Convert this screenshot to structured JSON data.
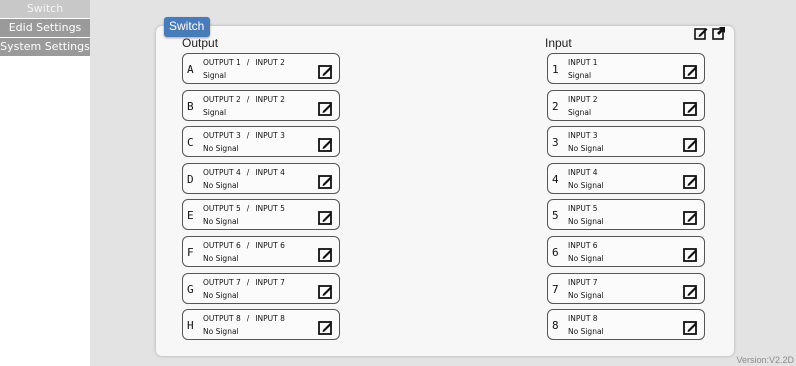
{
  "nav": {
    "items": [
      {
        "label": "Switch",
        "active": true
      },
      {
        "label": "Edid Settings",
        "active": false
      },
      {
        "label": "System Settings",
        "active": false
      }
    ]
  },
  "panel": {
    "tab_label": "Switch",
    "output_title": "Output",
    "input_title": "Input",
    "toolbar_icons": [
      "edit-all-icon",
      "open-external-icon"
    ]
  },
  "outputs": [
    {
      "letter": "A",
      "name": "OUTPUT 1",
      "sep": "/",
      "source": "INPUT 2",
      "status": "Signal"
    },
    {
      "letter": "B",
      "name": "OUTPUT 2",
      "sep": "/",
      "source": "INPUT 2",
      "status": "Signal"
    },
    {
      "letter": "C",
      "name": "OUTPUT 3",
      "sep": "/",
      "source": "INPUT 3",
      "status": "No Signal"
    },
    {
      "letter": "D",
      "name": "OUTPUT 4",
      "sep": "/",
      "source": "INPUT 4",
      "status": "No Signal"
    },
    {
      "letter": "E",
      "name": "OUTPUT 5",
      "sep": "/",
      "source": "INPUT 5",
      "status": "No Signal"
    },
    {
      "letter": "F",
      "name": "OUTPUT 6",
      "sep": "/",
      "source": "INPUT 6",
      "status": "No Signal"
    },
    {
      "letter": "G",
      "name": "OUTPUT 7",
      "sep": "/",
      "source": "INPUT 7",
      "status": "No Signal"
    },
    {
      "letter": "H",
      "name": "OUTPUT 8",
      "sep": "/",
      "source": "INPUT 8",
      "status": "No Signal"
    }
  ],
  "inputs": [
    {
      "number": "1",
      "name": "INPUT 1",
      "status": "Signal"
    },
    {
      "number": "2",
      "name": "INPUT 2",
      "status": "Signal"
    },
    {
      "number": "3",
      "name": "INPUT 3",
      "status": "No Signal"
    },
    {
      "number": "4",
      "name": "INPUT 4",
      "status": "No Signal"
    },
    {
      "number": "5",
      "name": "INPUT 5",
      "status": "No Signal"
    },
    {
      "number": "6",
      "name": "INPUT 6",
      "status": "No Signal"
    },
    {
      "number": "7",
      "name": "INPUT 7",
      "status": "No Signal"
    },
    {
      "number": "8",
      "name": "INPUT 8",
      "status": "No Signal"
    }
  ],
  "footer": {
    "version": "Version:V2.2D"
  },
  "colors": {
    "tab_blue": "#4a7ab8",
    "nav_gray": "#9a9a9a",
    "nav_active": "#c8c8c8",
    "background": "#e3e3e3"
  }
}
